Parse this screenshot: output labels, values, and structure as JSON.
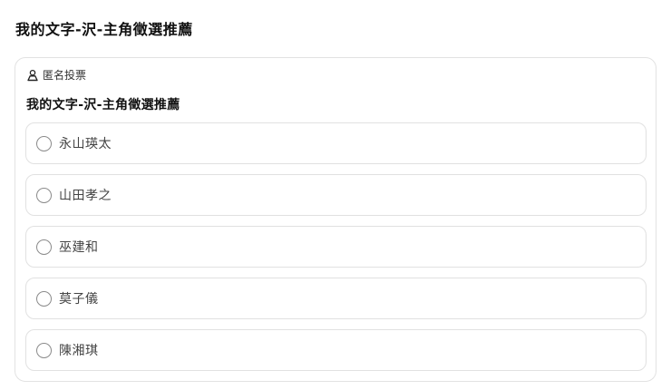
{
  "page": {
    "title": "我的文字-沢-主角徵選推薦"
  },
  "poll": {
    "mode_label": "匿名投票",
    "mode_icon": "anonymous-user-icon",
    "question": "我的文字-沢-主角徵選推薦",
    "options": [
      {
        "label": "永山瑛太",
        "selected": false
      },
      {
        "label": "山田孝之",
        "selected": false
      },
      {
        "label": "巫建和",
        "selected": false
      },
      {
        "label": "莫子儀",
        "selected": false
      },
      {
        "label": "陳湘琪",
        "selected": false
      }
    ]
  }
}
